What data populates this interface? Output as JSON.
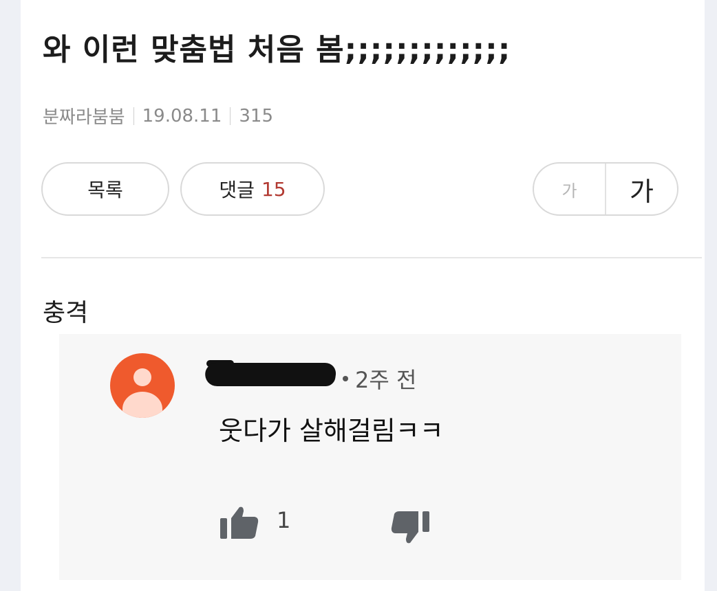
{
  "post": {
    "title": "와 이런 맞춤법 처음 봄;;;;;;;;;;;;;",
    "author": "분짜라붐붐",
    "date": "19.08.11",
    "views": "315",
    "body": "충격"
  },
  "toolbar": {
    "list_label": "목록",
    "comments_label": "댓글",
    "comments_count": "15",
    "font_small_label": "가",
    "font_large_label": "가"
  },
  "comment": {
    "time": "2주 전",
    "text": "웃다가 살해걸림ㅋㅋ",
    "likes": "1"
  },
  "colors": {
    "accent_count": "#b23a32",
    "avatar": "#ef5a2d"
  }
}
